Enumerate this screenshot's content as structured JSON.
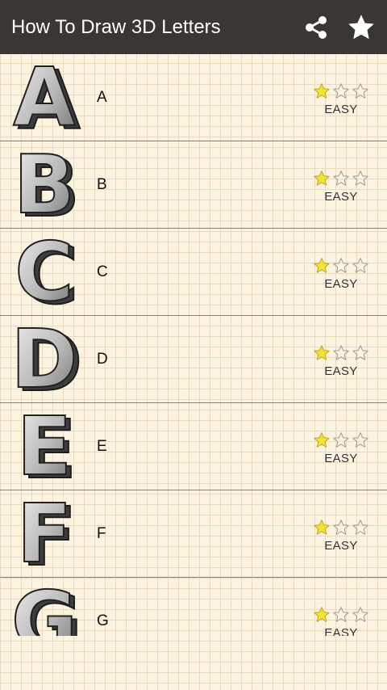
{
  "appbar": {
    "title": "How To Draw 3D Letters",
    "share_icon": "share-icon",
    "favorite_icon": "star-icon"
  },
  "colors": {
    "appbar_bg": "#3a3733",
    "paper_bg": "#fdf3e1",
    "star_filled": "#f2e23a",
    "star_outline": "#9a9a9a"
  },
  "lessons": [
    {
      "letter": "A",
      "label": "A",
      "rating": 1,
      "max_rating": 3,
      "difficulty": "EASY"
    },
    {
      "letter": "B",
      "label": "B",
      "rating": 1,
      "max_rating": 3,
      "difficulty": "EASY"
    },
    {
      "letter": "C",
      "label": "C",
      "rating": 1,
      "max_rating": 3,
      "difficulty": "EASY"
    },
    {
      "letter": "D",
      "label": "D",
      "rating": 1,
      "max_rating": 3,
      "difficulty": "EASY"
    },
    {
      "letter": "E",
      "label": "E",
      "rating": 1,
      "max_rating": 3,
      "difficulty": "EASY"
    },
    {
      "letter": "F",
      "label": "F",
      "rating": 1,
      "max_rating": 3,
      "difficulty": "EASY"
    },
    {
      "letter": "G",
      "label": "G",
      "rating": 1,
      "max_rating": 3,
      "difficulty": "EASY"
    }
  ]
}
